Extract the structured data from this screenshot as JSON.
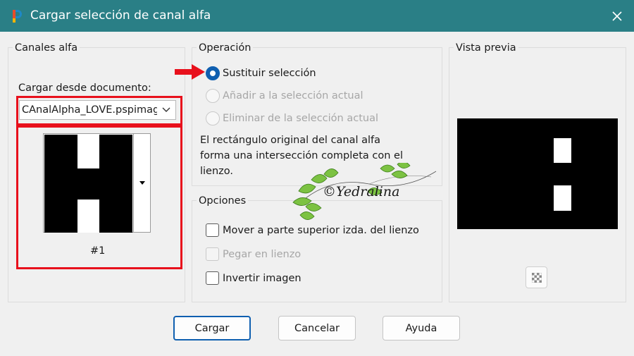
{
  "window": {
    "title": "Cargar selección de canal alfa"
  },
  "channels": {
    "group_title": "Canales alfa",
    "load_label": "Cargar desde documento:",
    "document": "CAnalAlpha_LOVE.pspimage",
    "channel_name": "#1"
  },
  "operation": {
    "group_title": "Operación",
    "options": [
      {
        "label": "Sustituir selección",
        "selected": true,
        "enabled": true
      },
      {
        "label": "Añadir a la selección actual",
        "selected": false,
        "enabled": false
      },
      {
        "label": "Eliminar de la selección actual",
        "selected": false,
        "enabled": false
      }
    ],
    "description": "El rectángulo original del canal alfa forma una intersección completa con el lienzo."
  },
  "options": {
    "group_title": "Opciones",
    "items": [
      {
        "label": "Mover a parte superior izda. del lienzo",
        "checked": false,
        "enabled": true
      },
      {
        "label": "Pegar en lienzo",
        "checked": false,
        "enabled": false
      },
      {
        "label": "Invertir imagen",
        "checked": false,
        "enabled": true
      }
    ]
  },
  "preview": {
    "group_title": "Vista previa"
  },
  "watermark": {
    "text": "©Yedralina"
  },
  "buttons": {
    "load": "Cargar",
    "cancel": "Cancelar",
    "help": "Ayuda"
  },
  "colors": {
    "titlebar": "#2a7f86",
    "highlight_red": "#e8101c",
    "accent_blue": "#0f5fb0",
    "leaf_green": "#7cc242"
  },
  "icons": {
    "app": "paintshop-pro-icon",
    "close": "close-icon",
    "arrow": "red-arrow-icon",
    "preview_toggle": "checkerboard-icon"
  }
}
